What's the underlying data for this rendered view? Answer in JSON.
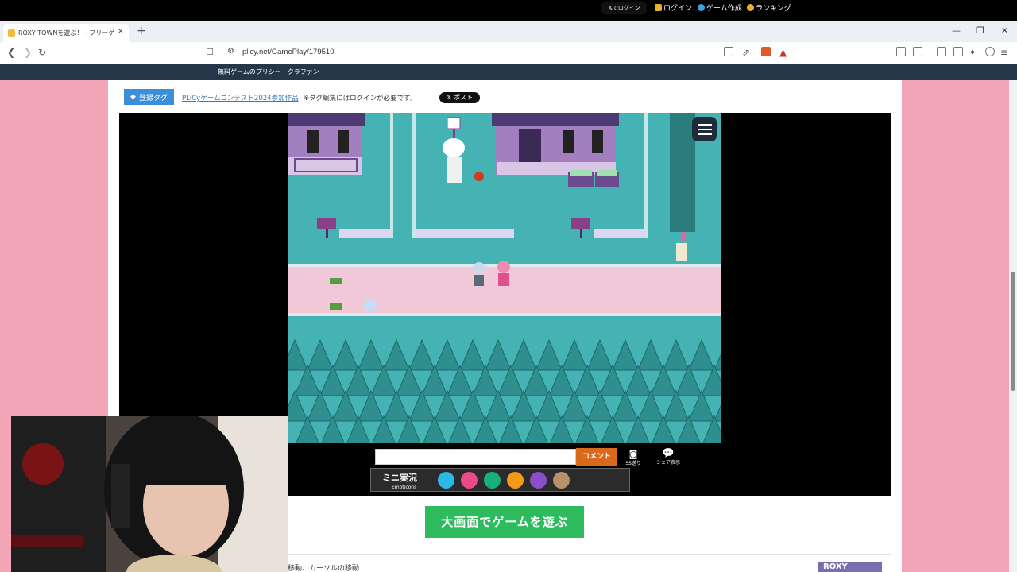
{
  "browser": {
    "tab_title": "ROXY TOWNを遊ぶ！ - フリーゲ",
    "tab_close": "×",
    "new_tab": "+",
    "url": "plicy.net/GamePlay/179510",
    "window_controls": [
      "—",
      "❐",
      "✕"
    ]
  },
  "site_header": {
    "brand": "無料ゲームのプリシー　クラファン",
    "x_login": "でログイン",
    "login": "ログイン",
    "create": "ゲーム作成",
    "ranking": "ランキング"
  },
  "tags": {
    "button": "登録タグ",
    "link": "PLiCyゲームコンテスト2024参加作品",
    "note": "※タグ編集にはログインが必要です。",
    "post": "ポスト"
  },
  "comment": {
    "input_value": "",
    "button": "コメント",
    "ss": "SS送り",
    "share": "シェア表示"
  },
  "mini": {
    "label": "ミニ実況",
    "sub": "Emoticons",
    "emoticons": [
      {
        "name": "smile",
        "color": "#2bb8e6"
      },
      {
        "name": "love",
        "color": "#e84a8a"
      },
      {
        "name": "laugh",
        "color": "#18b07a"
      },
      {
        "name": "surprise",
        "color": "#f29a1c"
      },
      {
        "name": "sad",
        "color": "#8a4fc8"
      },
      {
        "name": "meh",
        "color": "#b8906a"
      }
    ]
  },
  "big_play": "大画面でゲームを遊ぶ",
  "controls_text": "移動、カーソルの移動",
  "roxy_logo": "ROXY",
  "colors": {
    "header": "#26364a",
    "page_bg": "#f3a5b8",
    "grass": "#45b3b3",
    "path": "#f0c8d8",
    "accent_green": "#2dbb5e",
    "comment_orange": "#d9691d"
  }
}
